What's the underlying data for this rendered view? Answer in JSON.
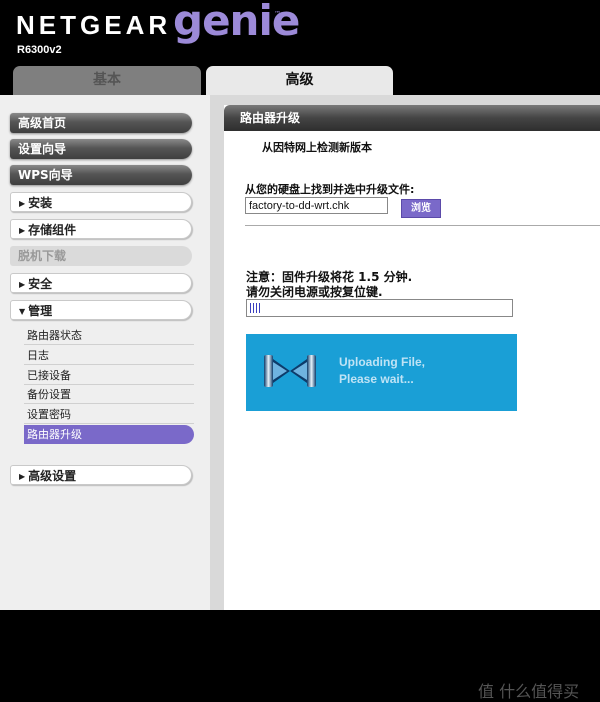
{
  "header": {
    "brand": "NETGEAR",
    "product": "genie",
    "tm": "™",
    "model": "R6300v2"
  },
  "tabs": [
    {
      "label": "基本",
      "active": false
    },
    {
      "label": "高级",
      "active": true
    }
  ],
  "sidebar": {
    "home": "高级首页",
    "wizard": "设置向导",
    "wps": "WPS向导",
    "setup": "安装",
    "usb_storage": "存储组件",
    "offline_download": "脱机下载",
    "security": "安全",
    "admin": "管理",
    "admin_items": [
      "路由器状态",
      "日志",
      "已接设备",
      "备份设置",
      "设置密码",
      "路由器升级"
    ],
    "advanced_setup": "高级设置"
  },
  "content": {
    "title": "路由器升级",
    "check_online": "从因特网上检测新版本",
    "locate_label": "从您的硬盘上找到并选中升级文件:",
    "file_value": "factory-to-dd-wrt.chk",
    "browse_label": "浏览",
    "notice_line1": "注意：固件升级将花 1.5 分钟.",
    "notice_line2": "请勿关闭电源或按复位键.",
    "progress": 0.04,
    "upload_line1": "Uploading File,",
    "upload_line2": "Please wait..."
  },
  "watermark": "值 什么值得买",
  "colors": {
    "accent_purple": "#7a69c9",
    "upload_blue": "#1a9fd6",
    "genie_purple": "#9c8ad8"
  }
}
